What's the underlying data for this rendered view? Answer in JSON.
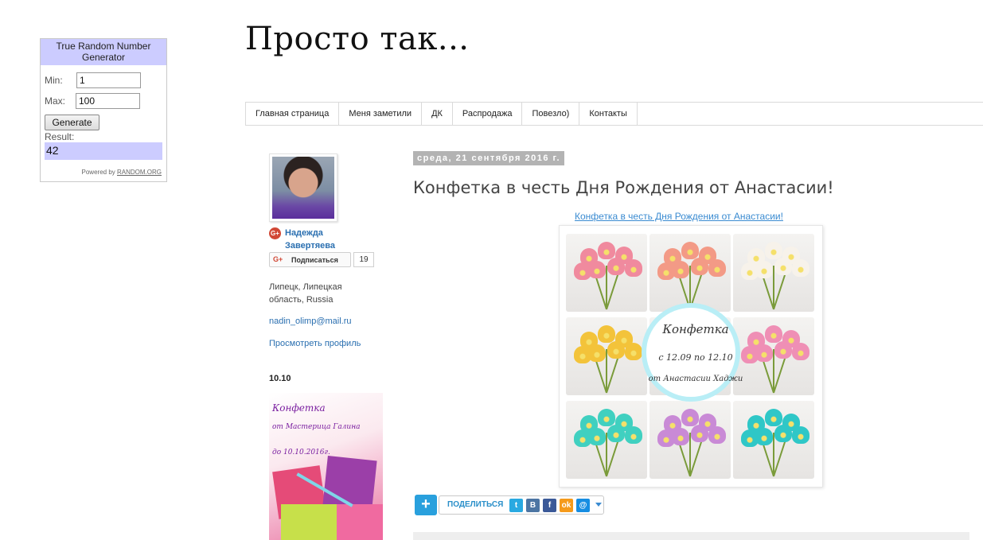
{
  "rng_widget": {
    "title": "True Random Number Generator",
    "min_label": "Min:",
    "min_value": "1",
    "max_label": "Max:",
    "max_value": "100",
    "generate_label": "Generate",
    "result_label": "Result:",
    "result_value": "42",
    "powered_by": "Powered by",
    "powered_link": "RANDOM.ORG"
  },
  "blog": {
    "title": "Просто так..."
  },
  "nav": {
    "tabs": [
      {
        "label": "Главная страница"
      },
      {
        "label": "Меня заметили"
      },
      {
        "label": "ДК"
      },
      {
        "label": "Распродажа"
      },
      {
        "label": "Повезло)"
      },
      {
        "label": "Контакты"
      }
    ]
  },
  "profile": {
    "name": "Надежда Завертяева",
    "follow_label": "Подписаться",
    "follow_count": "19",
    "location": "Липецк, Липецкая область, Russia",
    "email": "nadin_olimp@mail.ru",
    "view_profile": "Просмотреть профиль"
  },
  "sidebar_widget": {
    "title": "10.10",
    "promo_line1": "Конфетка",
    "promo_line2": "от Мастерица Галина",
    "promo_line3": "до 10.10.2016г."
  },
  "post": {
    "date": "среда, 21 сентября 2016 г.",
    "title": "Конфетка в честь Дня Рождения от Анастасии!",
    "link_text": "Конфетка в честь Дня Рождения от Анастасии!",
    "image_badge": {
      "line1": "Конфетка",
      "line2": "с 12.09 по 12.10",
      "line3": "от Анастасии Хаджи"
    },
    "flower_colors": [
      "#f08a9e",
      "#f39a86",
      "#f7f2ea",
      "#f3c33a",
      "#ef8fb5",
      "#40d0c0",
      "#c98ad6",
      "#2fc7c7"
    ]
  },
  "share": {
    "label": "ПОДЕЛИТЬСЯ",
    "icons": [
      {
        "name": "twitter-icon",
        "glyph": "t",
        "color": "#29a9e1"
      },
      {
        "name": "vkontakte-icon",
        "glyph": "B",
        "color": "#4c75a3"
      },
      {
        "name": "facebook-icon",
        "glyph": "f",
        "color": "#3b5998"
      },
      {
        "name": "odnoklassniki-icon",
        "glyph": "ok",
        "color": "#f59a1b"
      },
      {
        "name": "mailru-icon",
        "glyph": "@",
        "color": "#168de2"
      }
    ]
  }
}
